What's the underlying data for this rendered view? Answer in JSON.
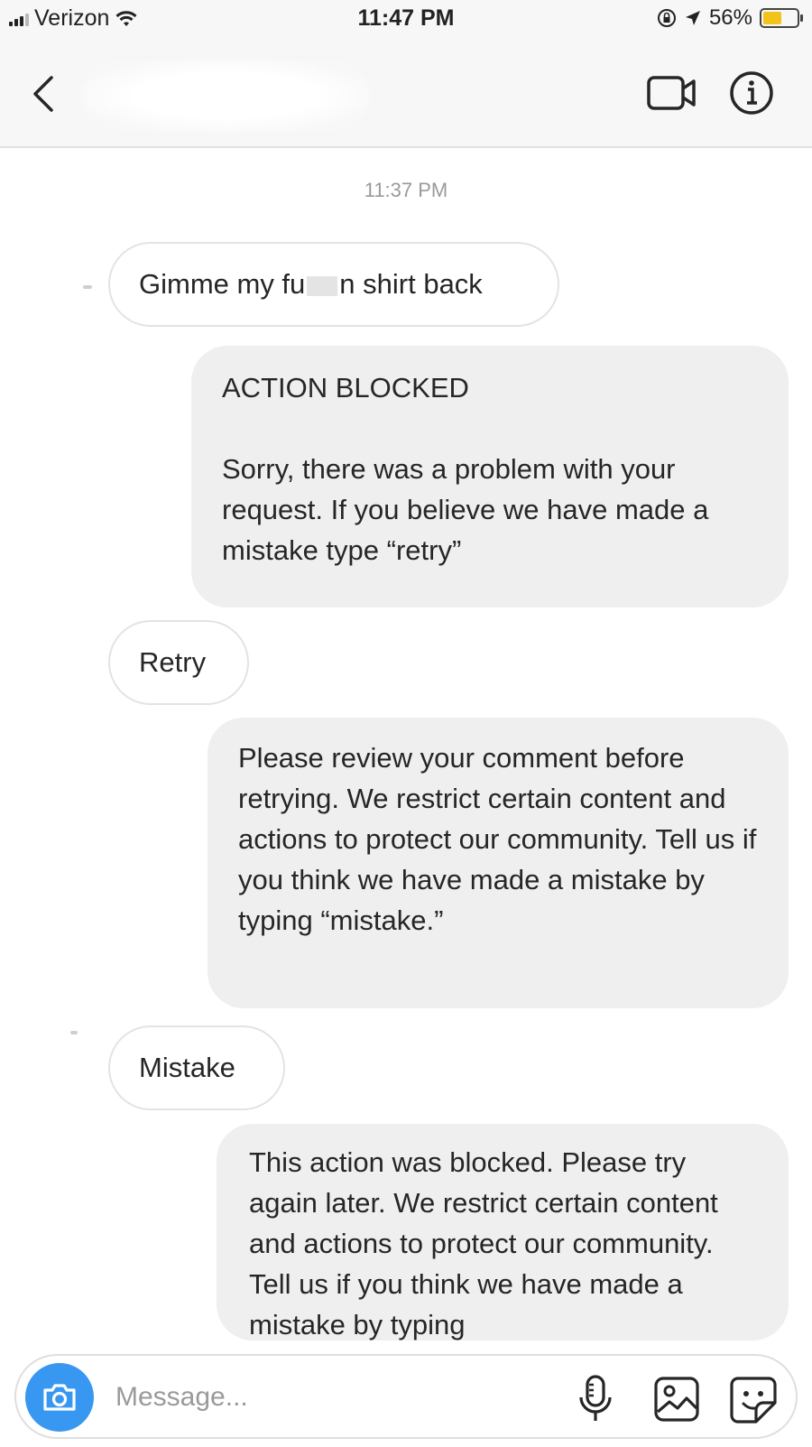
{
  "status_bar": {
    "carrier": "Verizon",
    "time": "11:47 PM",
    "battery": "56%",
    "battery_level": 0.56
  },
  "header": {
    "back_icon": "chevron-left-icon",
    "video_icon": "video-camera-icon",
    "info_icon": "info-icon"
  },
  "conversation": {
    "timestamp": "11:37 PM",
    "messages": [
      {
        "sender": "me",
        "text_before": "Gimme my fu",
        "text_after": "n shirt back"
      },
      {
        "sender": "them",
        "title": "ACTION BLOCKED",
        "text": "Sorry, there was a problem with your request. If you believe we have made a mistake type “retry”"
      },
      {
        "sender": "me",
        "text": "Retry"
      },
      {
        "sender": "them",
        "text": "Please review your comment before retrying. We restrict certain content and actions to protect our community. Tell us if you think we have made a mistake by typing “mistake.”"
      },
      {
        "sender": "me",
        "text": "Mistake"
      },
      {
        "sender": "them",
        "text": "This action was blocked. Please try again later. We restrict certain content and actions to protect our community. Tell us if you think we have made a mistake by typing"
      }
    ]
  },
  "composer": {
    "placeholder": "Message...",
    "icons": [
      "camera-icon",
      "microphone-icon",
      "gallery-icon",
      "sticker-icon"
    ]
  },
  "colors": {
    "accent": "#3897f0",
    "bubble_out": "#efefef",
    "bubble_in_border": "#e3e3e3",
    "battery": "#f2c31a"
  }
}
